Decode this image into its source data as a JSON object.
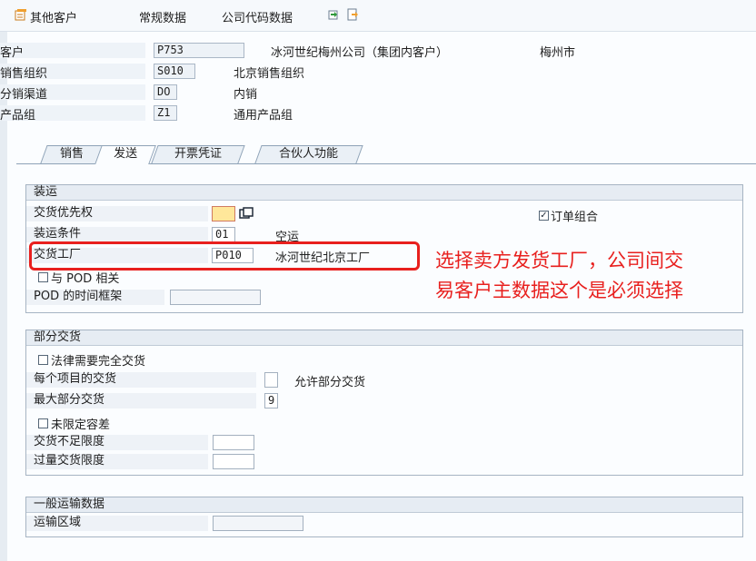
{
  "toolbar": {
    "other_customer": "其他客户",
    "general_data": "常规数据",
    "company_code_data": "公司代码数据"
  },
  "header": {
    "customer_label": "客户",
    "customer_value": "P753",
    "customer_name": "冰河世纪梅州公司（集团内客户）",
    "customer_city": "梅州市",
    "sales_org_label": "销售组织",
    "sales_org_value": "S010",
    "sales_org_desc": "北京销售组织",
    "dist_channel_label": "分销渠道",
    "dist_channel_value": "DO",
    "dist_channel_desc": "内销",
    "division_label": "产品组",
    "division_value": "Z1",
    "division_desc": "通用产品组"
  },
  "tabs": [
    "销售",
    "发送",
    "开票凭证",
    "合伙人功能"
  ],
  "active_tab": "发送",
  "shipping": {
    "title": "装运",
    "delivery_priority_label": "交货优先权",
    "order_combination_label": "订单组合",
    "order_combination_checked": true,
    "shipping_conditions_label": "装运条件",
    "shipping_conditions_value": "01",
    "shipping_conditions_desc": "空运",
    "delivering_plant_label": "交货工厂",
    "delivering_plant_value": "P010",
    "delivering_plant_desc": "冰河世纪北京工厂",
    "pod_relevant_label": "与 POD 相关",
    "pod_timeframe_label": "POD 的时间框架"
  },
  "partial": {
    "title": "部分交货",
    "complete_delivery_label": "法律需要完全交货",
    "per_item_label": "每个项目的交货",
    "partial_allowed_label": "允许部分交货",
    "max_partial_label": "最大部分交货",
    "max_partial_value": "9",
    "unlimited_tol_label": "未限定容差",
    "underdelivery_label": "交货不足限度",
    "overdelivery_label": "过量交货限度"
  },
  "transport": {
    "title": "一般运输数据",
    "zone_label": "运输区域"
  },
  "annotation": {
    "line1": "选择卖方发货工厂，公司间交",
    "line2": "易客户主数据这个是必须选择"
  },
  "colors": {
    "annotation": "#e8201e",
    "group_header": "#e6ecf3"
  }
}
